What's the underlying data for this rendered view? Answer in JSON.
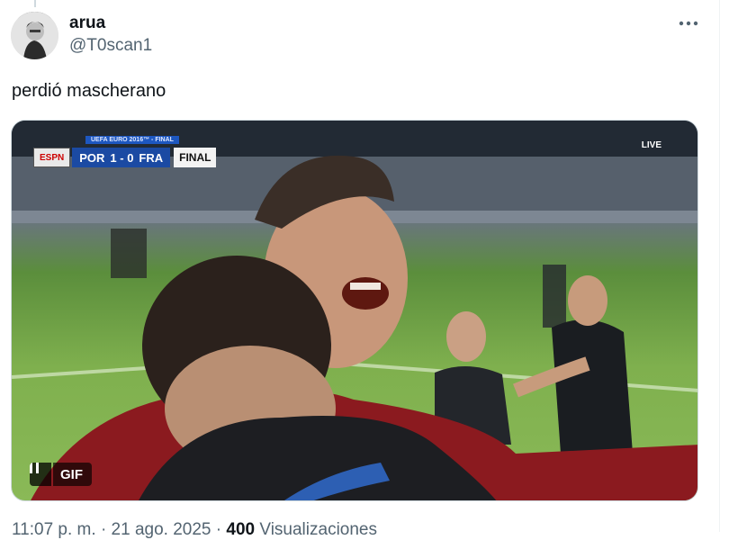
{
  "tweet": {
    "author": {
      "display_name": "arua",
      "handle": "@T0scan1"
    },
    "text": "perdió mascherano",
    "media": {
      "type_label": "GIF",
      "scorebug": {
        "network": "ESPN",
        "title": "UEFA EURO 2016™ - FINAL",
        "home": "POR",
        "score": "1 - 0",
        "away": "FRA",
        "status": "FINAL"
      },
      "live_label": "LIVE"
    },
    "meta": {
      "time": "11:07 p. m.",
      "date": "21 ago. 2025",
      "views_count": "400",
      "views_label": "Visualizaciones"
    }
  },
  "icons": {
    "more": "more-horizontal-icon",
    "pause": "pause-icon"
  },
  "colors": {
    "text": "#0f1419",
    "secondary": "#536471",
    "border": "#cfd9de"
  }
}
